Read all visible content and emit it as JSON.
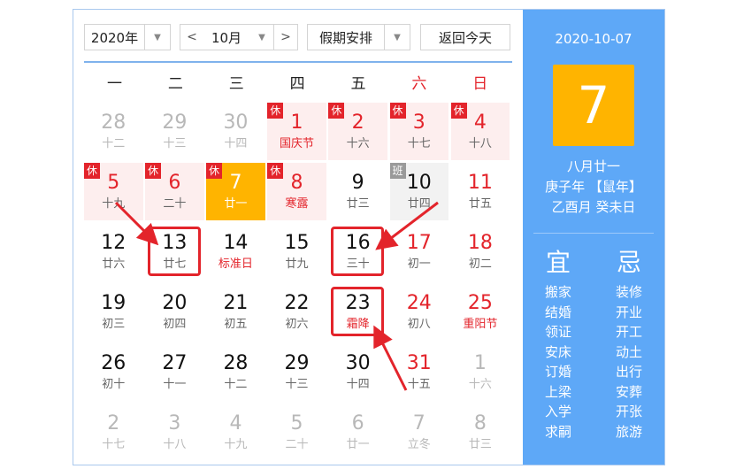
{
  "toolbar": {
    "year": "2020年",
    "prev": "<",
    "month": "10月",
    "next": ">",
    "holiday_select": "假期安排",
    "today_button": "返回今天"
  },
  "weekdays": [
    "一",
    "二",
    "三",
    "四",
    "五",
    "六",
    "日"
  ],
  "days": [
    {
      "n": "28",
      "s": "十二",
      "grey": true
    },
    {
      "n": "29",
      "s": "十三",
      "grey": true
    },
    {
      "n": "30",
      "s": "十四",
      "grey": true
    },
    {
      "n": "1",
      "s": "国庆节",
      "tag": "休",
      "red": true,
      "fest": true,
      "holiday": true
    },
    {
      "n": "2",
      "s": "十六",
      "tag": "休",
      "red": true,
      "holiday": true
    },
    {
      "n": "3",
      "s": "十七",
      "tag": "休",
      "red": true,
      "holiday": true
    },
    {
      "n": "4",
      "s": "十八",
      "tag": "休",
      "red": true,
      "holiday": true
    },
    {
      "n": "5",
      "s": "十九",
      "tag": "休",
      "red": true,
      "holiday": true
    },
    {
      "n": "6",
      "s": "二十",
      "tag": "休",
      "red": true,
      "holiday": true
    },
    {
      "n": "7",
      "s": "廿一",
      "tag": "休",
      "today": true
    },
    {
      "n": "8",
      "s": "寒露",
      "tag": "休",
      "red": true,
      "fest": true,
      "holiday": true
    },
    {
      "n": "9",
      "s": "廿三"
    },
    {
      "n": "10",
      "s": "廿四",
      "tag": "班",
      "workday": true
    },
    {
      "n": "11",
      "s": "廿五",
      "red": true
    },
    {
      "n": "12",
      "s": "廿六"
    },
    {
      "n": "13",
      "s": "廿七"
    },
    {
      "n": "14",
      "s": "标准日",
      "fest": true
    },
    {
      "n": "15",
      "s": "廿九"
    },
    {
      "n": "16",
      "s": "三十"
    },
    {
      "n": "17",
      "s": "初一",
      "red": true
    },
    {
      "n": "18",
      "s": "初二",
      "red": true
    },
    {
      "n": "19",
      "s": "初三"
    },
    {
      "n": "20",
      "s": "初四"
    },
    {
      "n": "21",
      "s": "初五"
    },
    {
      "n": "22",
      "s": "初六"
    },
    {
      "n": "23",
      "s": "霜降",
      "fest": true
    },
    {
      "n": "24",
      "s": "初八",
      "red": true
    },
    {
      "n": "25",
      "s": "重阳节",
      "red": true,
      "fest": true
    },
    {
      "n": "26",
      "s": "初十"
    },
    {
      "n": "27",
      "s": "十一"
    },
    {
      "n": "28",
      "s": "十二"
    },
    {
      "n": "29",
      "s": "十三"
    },
    {
      "n": "30",
      "s": "十四"
    },
    {
      "n": "31",
      "s": "十五",
      "red": true
    },
    {
      "n": "1",
      "s": "十六",
      "grey": true
    },
    {
      "n": "2",
      "s": "十七",
      "grey": true
    },
    {
      "n": "3",
      "s": "十八",
      "grey": true
    },
    {
      "n": "4",
      "s": "十九",
      "grey": true
    },
    {
      "n": "5",
      "s": "二十",
      "grey": true
    },
    {
      "n": "6",
      "s": "廿一",
      "grey": true
    },
    {
      "n": "7",
      "s": "立冬",
      "grey": true
    },
    {
      "n": "8",
      "s": "廿三",
      "grey": true
    }
  ],
  "highlighted_days": [
    "13",
    "16",
    "23"
  ],
  "panel": {
    "date": "2020-10-07",
    "day": "7",
    "lunar_lines": [
      "八月廿一",
      "庚子年 【鼠年】",
      "乙酉月 癸未日"
    ],
    "yi_title": "宜",
    "ji_title": "忌",
    "yi": [
      "搬家",
      "结婚",
      "领证",
      "安床",
      "订婚",
      "上梁",
      "入学",
      "求嗣"
    ],
    "ji": [
      "装修",
      "开业",
      "开工",
      "动土",
      "出行",
      "安葬",
      "开张",
      "旅游"
    ]
  },
  "colors": {
    "accent_blue": "#5ea8f7",
    "today_orange": "#ffb400",
    "holiday_red": "#e3242b",
    "holiday_bg": "#fdeeee"
  }
}
